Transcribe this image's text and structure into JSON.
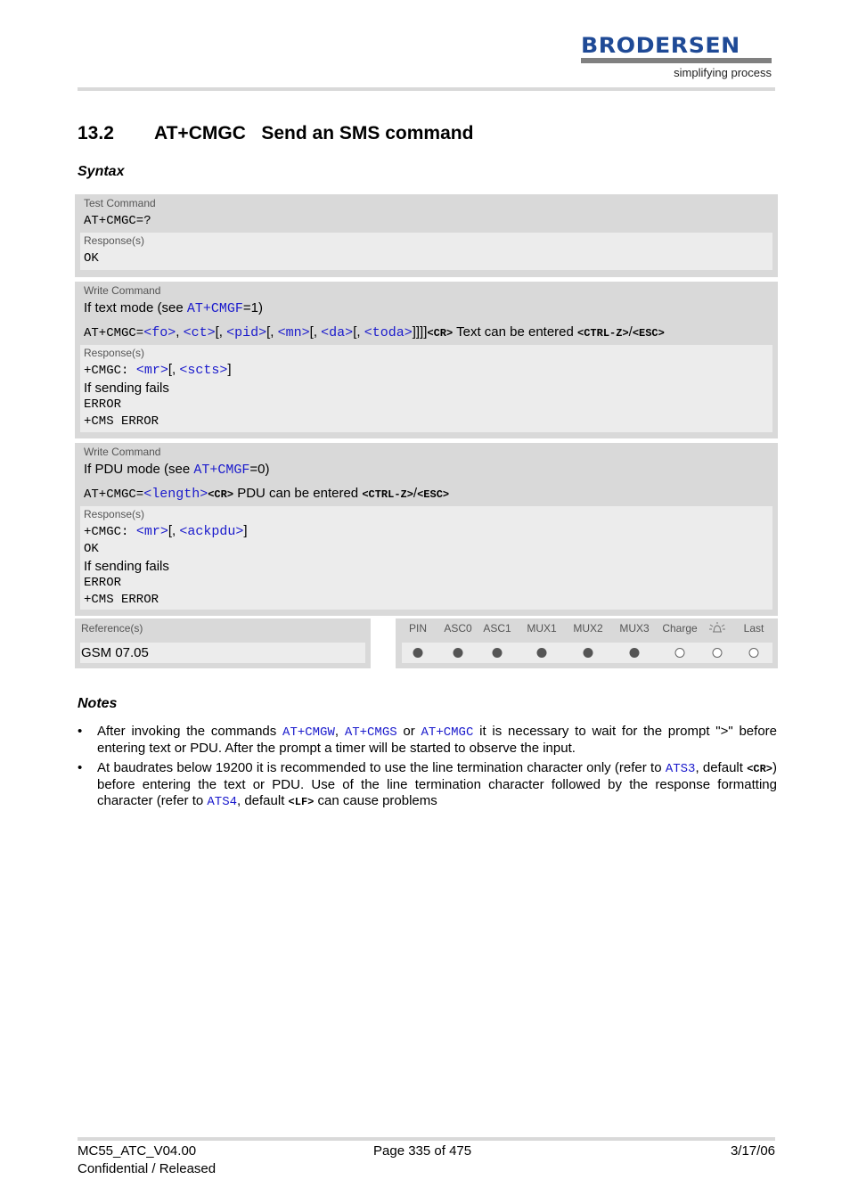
{
  "header": {
    "logo_word": "BRODERSEN",
    "logo_tagline": "simplifying process"
  },
  "title": {
    "number": "13.2",
    "text": "AT+CMGC   Send an SMS command"
  },
  "syntax_heading": "Syntax",
  "test_command": {
    "label": "Test Command",
    "command": "AT+CMGC=?",
    "response_label": "Response(s)",
    "response": "OK"
  },
  "write_text": {
    "label": "Write Command",
    "intro_prefix": "If text mode (see ",
    "intro_link": "AT+CMGF",
    "intro_suffix": "=1)",
    "cmd_prefix": "AT+CMGC=",
    "params": [
      "<fo>",
      "<ct>",
      "<pid>",
      "<mn>",
      "<da>",
      "<toda>"
    ],
    "sep1": ", ",
    "sep_opt": "[, ",
    "close": "]]]]",
    "cr": "<CR>",
    "enter_text": " Text can be entered ",
    "ctrlz": "<CTRL-Z>",
    "slash": "/",
    "esc": "<ESC>",
    "response_label": "Response(s)",
    "resp_prefix": "+CMGC: ",
    "resp_p1": "<mr>",
    "resp_sep": "[, ",
    "resp_p2": "<scts>",
    "resp_close": "]",
    "fail_text": "If sending fails",
    "error": "ERROR",
    "cms_error": "+CMS ERROR"
  },
  "write_pdu": {
    "label": "Write Command",
    "intro_prefix": "If PDU mode (see ",
    "intro_link": "AT+CMGF",
    "intro_suffix": "=0)",
    "cmd_prefix": "AT+CMGC=",
    "param": "<length>",
    "cr": "<CR>",
    "enter_text": " PDU can be entered ",
    "ctrlz": "<CTRL-Z>",
    "slash": "/",
    "esc": "<ESC>",
    "response_label": "Response(s)",
    "resp_prefix": "+CMGC: ",
    "resp_p1": "<mr>",
    "resp_sep": "[, ",
    "resp_p2": "<ackpdu>",
    "resp_close": "]",
    "ok": "OK",
    "fail_text": "If sending fails",
    "error": "ERROR",
    "cms_error": "+CMS ERROR"
  },
  "reference": {
    "label": "Reference(s)",
    "value": "GSM 07.05"
  },
  "pins": [
    {
      "label": "PIN",
      "supported": true
    },
    {
      "label": "ASC0",
      "supported": true
    },
    {
      "label": "ASC1",
      "supported": true
    },
    {
      "label": "MUX1",
      "supported": true
    },
    {
      "label": "MUX2",
      "supported": true
    },
    {
      "label": "MUX3",
      "supported": true
    },
    {
      "label": "Charge",
      "supported": false
    },
    {
      "label": "",
      "icon": "alarm-bell-icon",
      "supported": false
    },
    {
      "label": "Last",
      "supported": false
    }
  ],
  "notes": {
    "heading": "Notes",
    "bullet": "•",
    "n1": {
      "t1": "After invoking the commands ",
      "l1": "AT+CMGW",
      "t2": ", ",
      "l2": "AT+CMGS",
      "t3": " or ",
      "l3": "AT+CMGC",
      "t4": " it is necessary to wait for the prompt \">\" before entering text or PDU. After the prompt a timer will be started to observe the input."
    },
    "n2": {
      "t1": "At baudrates below 19200 it is recommended to use the line termination character only (refer to ",
      "l1": "ATS3",
      "t2": ", default ",
      "s1": "<CR>",
      "t3": ") before entering the text or PDU. Use of the line termination character followed by the response formatting character (refer to ",
      "l2": "ATS4",
      "t4": ", default ",
      "s2": "<LF>",
      "t5": " can cause problems"
    }
  },
  "footer": {
    "doc_id": "MC55_ATC_V04.00",
    "status": "Confidential / Released",
    "page": "Page 335 of 475",
    "date": "3/17/06"
  }
}
